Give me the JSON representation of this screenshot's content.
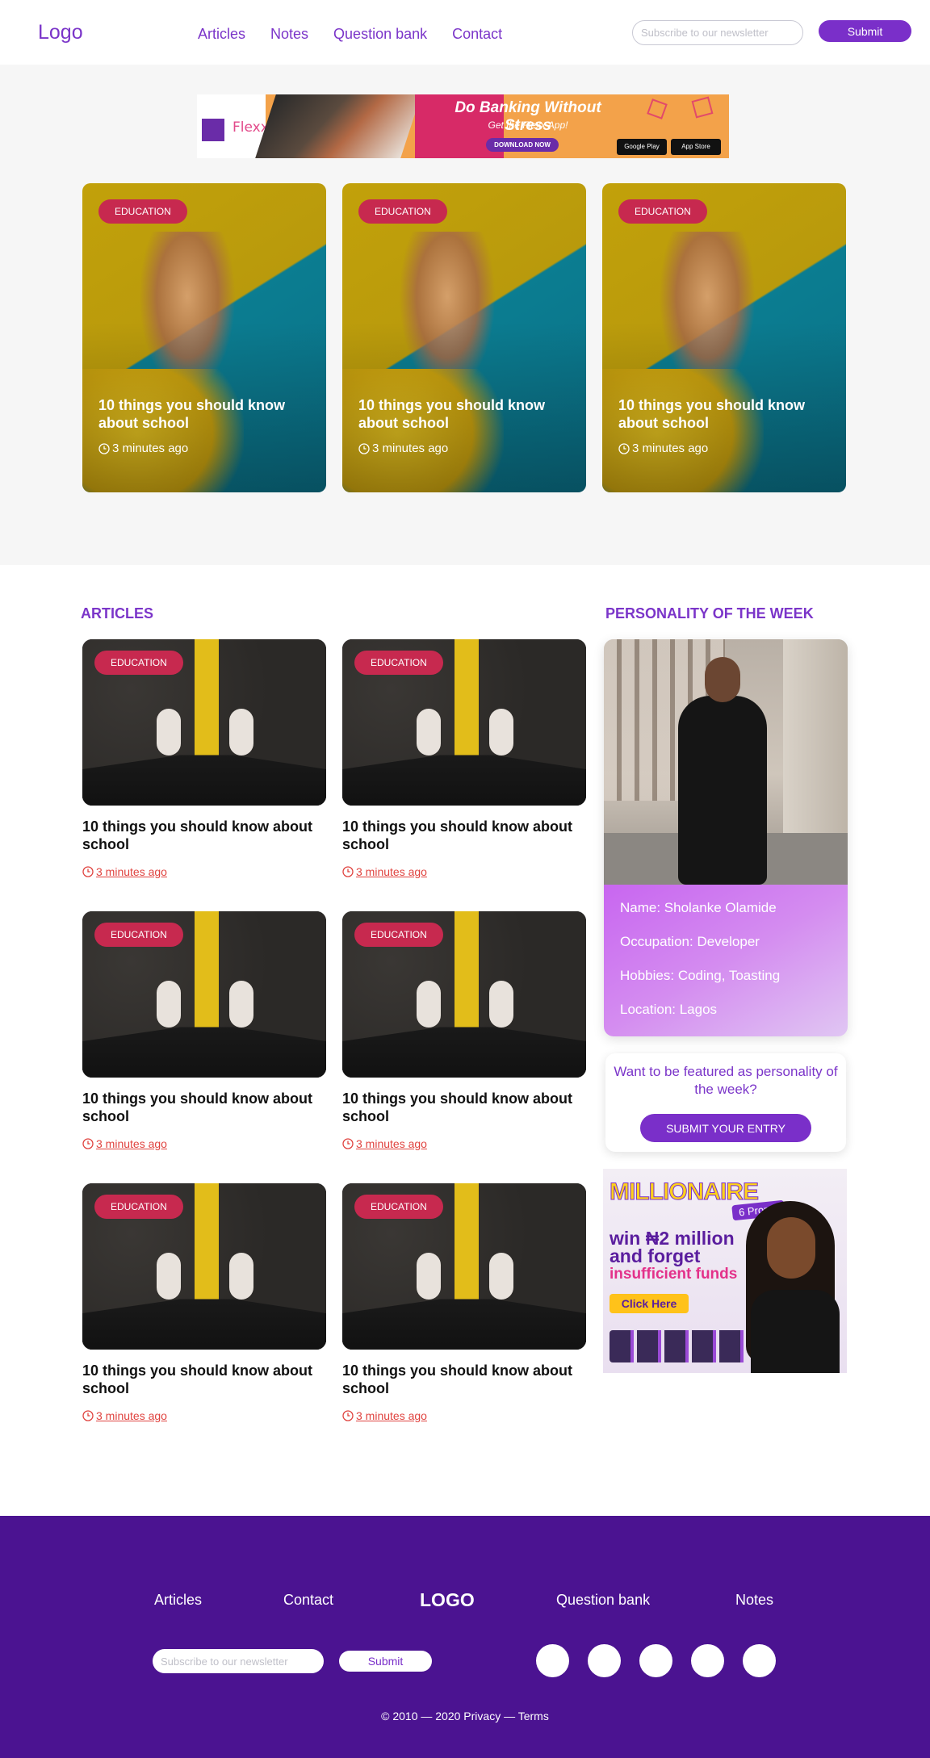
{
  "header": {
    "logo": "Logo",
    "nav": [
      "Articles",
      "Notes",
      "Question bank",
      "Contact"
    ],
    "newsletter_placeholder": "Subscribe to our newsletter",
    "submit_label": "Submit"
  },
  "banner": {
    "brand": "Flexx",
    "headline": "Do Banking Without Stress",
    "subline": "Get the Flexx App!",
    "cta": "DOWNLOAD NOW",
    "store_1": "Google Play",
    "store_2": "App Store"
  },
  "featured": [
    {
      "tag": "EDUCATION",
      "title": "10 things you should know about school",
      "time": "3 minutes ago"
    },
    {
      "tag": "EDUCATION",
      "title": "10 things you should know about school",
      "time": "3 minutes ago"
    },
    {
      "tag": "EDUCATION",
      "title": "10 things you should know about school",
      "time": "3 minutes ago"
    }
  ],
  "articles_section": {
    "title": "ARTICLES",
    "items": [
      {
        "tag": "EDUCATION",
        "title": "10 things you should know about school",
        "time": "3 minutes ago"
      },
      {
        "tag": "EDUCATION",
        "title": "10 things you should know about school",
        "time": "3 minutes ago"
      },
      {
        "tag": "EDUCATION",
        "title": "10 things you should know about school",
        "time": "3 minutes ago"
      },
      {
        "tag": "EDUCATION",
        "title": "10 things you should know about school",
        "time": "3 minutes ago"
      },
      {
        "tag": "EDUCATION",
        "title": "10 things you should know about school",
        "time": "3 minutes ago"
      },
      {
        "tag": "EDUCATION",
        "title": "10 things you should know about school",
        "time": "3 minutes ago"
      }
    ]
  },
  "personality": {
    "title": "PERSONALITY OF THE WEEK",
    "name": "Name: Sholanke Olamide",
    "occupation": "Occupation: Developer",
    "hobbies": "Hobbies: Coding, Toasting",
    "location": "Location: Lagos",
    "feature_prompt": "Want to be featured as personality of the week?",
    "feature_button": "SUBMIT YOUR ENTRY"
  },
  "promo": {
    "title": "MILLIONAIRE",
    "badge": "Promo",
    "season": "6",
    "line1": "win ₦2 million",
    "line2": "and forget",
    "line3": "insufficient funds",
    "cta": "Click Here"
  },
  "footer": {
    "links": [
      "Articles",
      "Contact",
      "Question bank",
      "Notes"
    ],
    "logo": "LOGO",
    "newsletter_placeholder": "Subscribe to our newsletter",
    "submit_label": "Submit",
    "copyright": "© 2010 — 2020   Privacy — Terms"
  },
  "colors": {
    "brand_purple": "#7b35c9",
    "footer_purple": "#4b1391",
    "tag_red": "#c7294f",
    "time_red": "#e0433f"
  }
}
